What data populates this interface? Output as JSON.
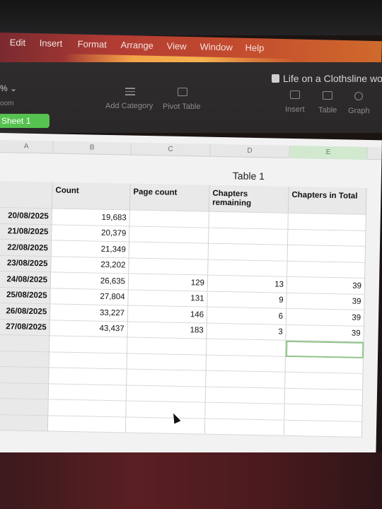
{
  "menubar": {
    "items": [
      "Edit",
      "Insert",
      "Format",
      "Arrange",
      "View",
      "Window",
      "Help"
    ]
  },
  "toolbar": {
    "document_title": "Life on a Clothsline wor",
    "zoom_value": "% ⌄",
    "zoom_label": "oom",
    "add_category_label": "Add Category",
    "pivot_table_label": "Pivot Table",
    "insert_label": "Insert",
    "table_label": "Table",
    "graph_label": "Graph"
  },
  "sheet_tab": {
    "label": "Sheet 1"
  },
  "columns": [
    "A",
    "B",
    "C",
    "D",
    "E"
  ],
  "table": {
    "title": "Table 1",
    "headers": [
      "",
      "Count",
      "Page count",
      "Chapters remaining",
      "Chapters in Total"
    ],
    "rows": [
      [
        "20/08/2025",
        "19,683",
        "",
        "",
        ""
      ],
      [
        "21/08/2025",
        "20,379",
        "",
        "",
        ""
      ],
      [
        "22/08/2025",
        "21,349",
        "",
        "",
        ""
      ],
      [
        "23/08/2025",
        "23,202",
        "",
        "",
        ""
      ],
      [
        "24/08/2025",
        "26,635",
        "129",
        "13",
        "39"
      ],
      [
        "25/08/2025",
        "27,804",
        "131",
        "9",
        "39"
      ],
      [
        "26/08/2025",
        "33,227",
        "146",
        "6",
        "39"
      ],
      [
        "27/08/2025",
        "43,437",
        "183",
        "3",
        "39"
      ],
      [
        "",
        "",
        "",
        "",
        ""
      ],
      [
        "",
        "",
        "",
        "",
        ""
      ],
      [
        "",
        "",
        "",
        "",
        ""
      ],
      [
        "",
        "",
        "",
        "",
        ""
      ],
      [
        "",
        "",
        "",
        "",
        ""
      ],
      [
        "",
        "",
        "",
        "",
        ""
      ]
    ]
  },
  "colors": {
    "accent_green": "#56c24f",
    "selection_outline": "#8fc487"
  }
}
